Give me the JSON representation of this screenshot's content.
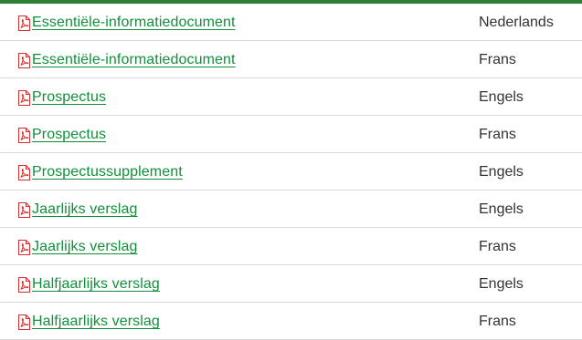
{
  "colors": {
    "accent": "#2e7d32",
    "link": "#118f3b",
    "text": "#333333",
    "divider": "#d9d9d9",
    "pdf_icon": "#d32f2f"
  },
  "documents": [
    {
      "title": "Essentiële-informatiedocument",
      "language": "Nederlands",
      "icon": "pdf-icon"
    },
    {
      "title": "Essentiële-informatiedocument",
      "language": "Frans",
      "icon": "pdf-icon"
    },
    {
      "title": "Prospectus",
      "language": "Engels",
      "icon": "pdf-icon"
    },
    {
      "title": "Prospectus",
      "language": "Frans",
      "icon": "pdf-icon"
    },
    {
      "title": "Prospectussupplement",
      "language": "Engels",
      "icon": "pdf-icon"
    },
    {
      "title": "Jaarlijks verslag",
      "language": "Engels",
      "icon": "pdf-icon"
    },
    {
      "title": "Jaarlijks verslag",
      "language": "Frans",
      "icon": "pdf-icon"
    },
    {
      "title": "Halfjaarlijks verslag",
      "language": "Engels",
      "icon": "pdf-icon"
    },
    {
      "title": "Halfjaarlijks verslag",
      "language": "Frans",
      "icon": "pdf-icon"
    }
  ]
}
